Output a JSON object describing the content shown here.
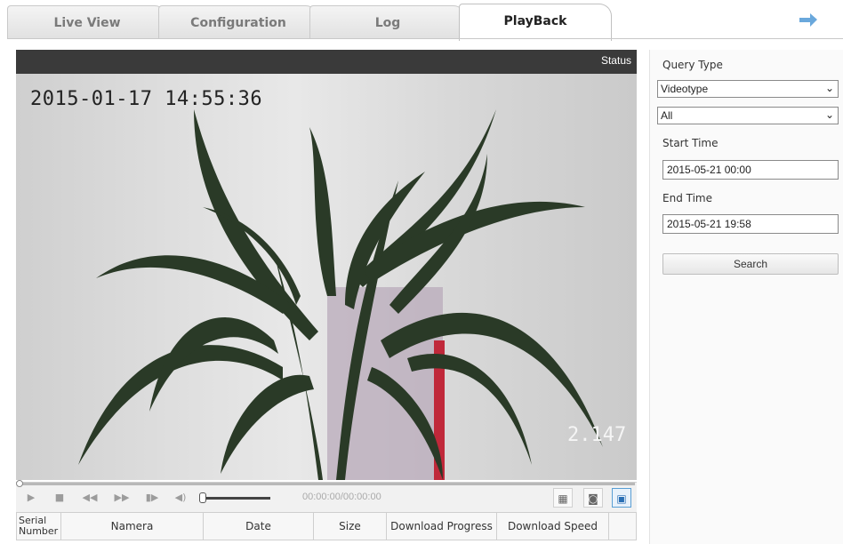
{
  "tabs": [
    {
      "label": "Live View",
      "active": false
    },
    {
      "label": "Configuration",
      "active": false
    },
    {
      "label": "Log",
      "active": false
    },
    {
      "label": "PlayBack",
      "active": true
    }
  ],
  "nav_icon": "arrow-right-icon",
  "video": {
    "status_label": "Status",
    "osd_timestamp": "2015-01-17 14:55:36",
    "osd_number": "2.147"
  },
  "controls": {
    "time_display": "00:00:00/00:00:00",
    "icons": [
      "play-icon",
      "stop-icon",
      "rewind-icon",
      "fast-forward-icon",
      "step-frame-icon",
      "volume-icon",
      "fullscreen-icon",
      "snapshot-icon",
      "window-icon"
    ]
  },
  "table": {
    "columns": [
      "Serial Number",
      "Namera",
      "Date",
      "Size",
      "Download Progress",
      "Download Speed",
      ""
    ]
  },
  "panel": {
    "query_type_label": "Query Type",
    "video_type_value": "Videotype",
    "filter_value": "All",
    "start_time_label": "Start Time",
    "start_time_value": "2015-05-21 00:00",
    "end_time_label": "End Time",
    "end_time_value": "2015-05-21 19:58",
    "search_label": "Search"
  },
  "colors": {
    "accent": "#5a9fd4",
    "header_bar": "#3a3a3a"
  }
}
